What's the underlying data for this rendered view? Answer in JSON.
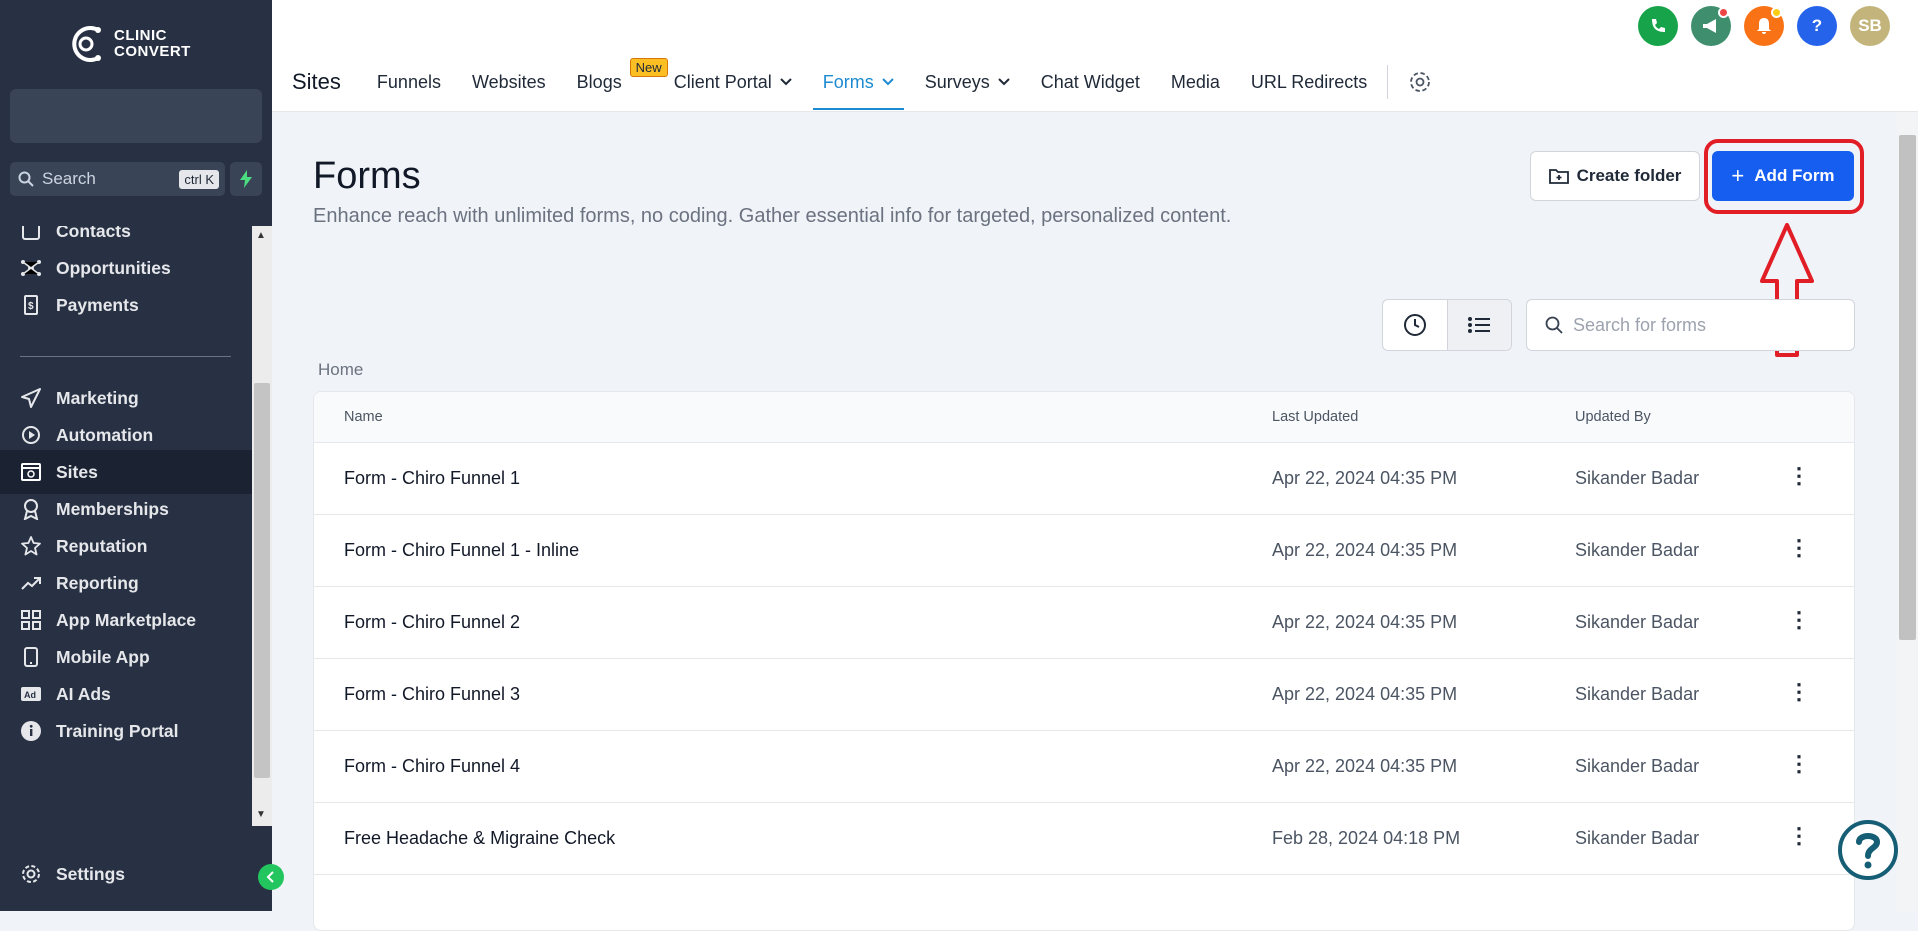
{
  "sidebar": {
    "logo_line1": "CLINIC",
    "logo_line2": "CONVERT",
    "search_placeholder": "Search",
    "search_shortcut": "ctrl K",
    "items": [
      {
        "label": "Contacts",
        "icon": "contacts-icon"
      },
      {
        "label": "Opportunities",
        "icon": "opportunities-icon"
      },
      {
        "label": "Payments",
        "icon": "payments-icon"
      },
      {
        "label": "Marketing",
        "icon": "send-icon"
      },
      {
        "label": "Automation",
        "icon": "automation-icon"
      },
      {
        "label": "Sites",
        "icon": "sites-icon",
        "active": true
      },
      {
        "label": "Memberships",
        "icon": "award-icon"
      },
      {
        "label": "Reputation",
        "icon": "star-icon"
      },
      {
        "label": "Reporting",
        "icon": "trend-icon"
      },
      {
        "label": "App Marketplace",
        "icon": "grid-icon"
      },
      {
        "label": "Mobile App",
        "icon": "mobile-icon"
      },
      {
        "label": "AI Ads",
        "icon": "ads-icon"
      },
      {
        "label": "Training Portal",
        "icon": "info-icon"
      }
    ],
    "settings_label": "Settings"
  },
  "header": {
    "avatar_initials": "SB",
    "help_label": "?",
    "section_title": "Sites",
    "tabs": [
      {
        "label": "Funnels"
      },
      {
        "label": "Websites"
      },
      {
        "label": "Blogs",
        "badge": "New"
      },
      {
        "label": "Client Portal",
        "dropdown": true
      },
      {
        "label": "Forms",
        "dropdown": true,
        "active": true
      },
      {
        "label": "Surveys",
        "dropdown": true
      },
      {
        "label": "Chat Widget"
      },
      {
        "label": "Media"
      },
      {
        "label": "URL Redirects"
      }
    ],
    "colors": {
      "phone": "#16a34a",
      "announce": "#3f8f6f",
      "bell": "#f97316",
      "help": "#2563eb",
      "avatar": "#c2b47a",
      "accent": "#1d8bd1"
    }
  },
  "main": {
    "title": "Forms",
    "description": "Enhance reach with unlimited forms, no coding. Gather essential info for targeted, personalized content.",
    "create_folder_label": "Create folder",
    "add_form_label": "Add Form",
    "search_placeholder": "Search for forms",
    "breadcrumb": "Home",
    "columns": [
      "Name",
      "Last Updated",
      "Updated By"
    ],
    "rows": [
      {
        "name": "Form - Chiro Funnel 1",
        "updated": "Apr 22, 2024 04:35 PM",
        "by": "Sikander Badar"
      },
      {
        "name": "Form - Chiro Funnel 1 - Inline",
        "updated": "Apr 22, 2024 04:35 PM",
        "by": "Sikander Badar"
      },
      {
        "name": "Form - Chiro Funnel 2",
        "updated": "Apr 22, 2024 04:35 PM",
        "by": "Sikander Badar"
      },
      {
        "name": "Form - Chiro Funnel 3",
        "updated": "Apr 22, 2024 04:35 PM",
        "by": "Sikander Badar"
      },
      {
        "name": "Form - Chiro Funnel 4",
        "updated": "Apr 22, 2024 04:35 PM",
        "by": "Sikander Badar"
      },
      {
        "name": "Free Headache & Migraine Check",
        "updated": "Feb 28, 2024 04:18 PM",
        "by": "Sikander Badar"
      }
    ],
    "row_menu_glyph": "⋮"
  }
}
